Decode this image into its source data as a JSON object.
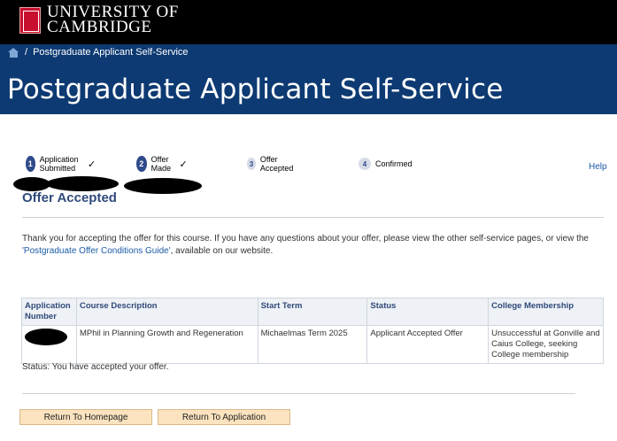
{
  "header": {
    "brand_line1": "UNIVERSITY OF",
    "brand_line2": "CAMBRIDGE",
    "breadcrumb_separator": "/",
    "breadcrumb_current": "Postgraduate Applicant Self-Service",
    "banner_title": "Postgraduate Applicant Self-Service",
    "colors": {
      "top_bar": "#000000",
      "banner": "#0d3a72"
    }
  },
  "steps": [
    {
      "number": "1",
      "label": "Application Submitted",
      "check": "✓",
      "state": "done"
    },
    {
      "number": "2",
      "label": "Offer Made",
      "check": "✓",
      "state": "done"
    },
    {
      "number": "3",
      "label": "Offer Accepted",
      "check": "",
      "state": "todo"
    },
    {
      "number": "4",
      "label": "Confirmed",
      "check": "",
      "state": "todo"
    }
  ],
  "help_label": "Help",
  "section_title": "Offer Accepted",
  "message": {
    "text_before": "Thank you for accepting the offer for this course. If you have any questions about your offer, please view the other self-service pages, or view the ",
    "link_text": "'Postgraduate Offer Conditions Guide'",
    "text_after": ", available on our website."
  },
  "table": {
    "columns": [
      "Application Number",
      "Course Description",
      "Start Term",
      "Status",
      "College Membership"
    ],
    "rows": [
      {
        "application_number": "",
        "course_description": "MPhil in Planning  Growth and Regeneration",
        "start_term": "Michaelmas Term 2025",
        "status": "Applicant Accepted Offer",
        "college_membership": "Unsuccessful at Gonville and Caius College, seeking College membership"
      }
    ]
  },
  "status_line": "Status: You have accepted your offer.",
  "buttons": {
    "homepage": "Return To Homepage",
    "application": "Return To Application"
  }
}
